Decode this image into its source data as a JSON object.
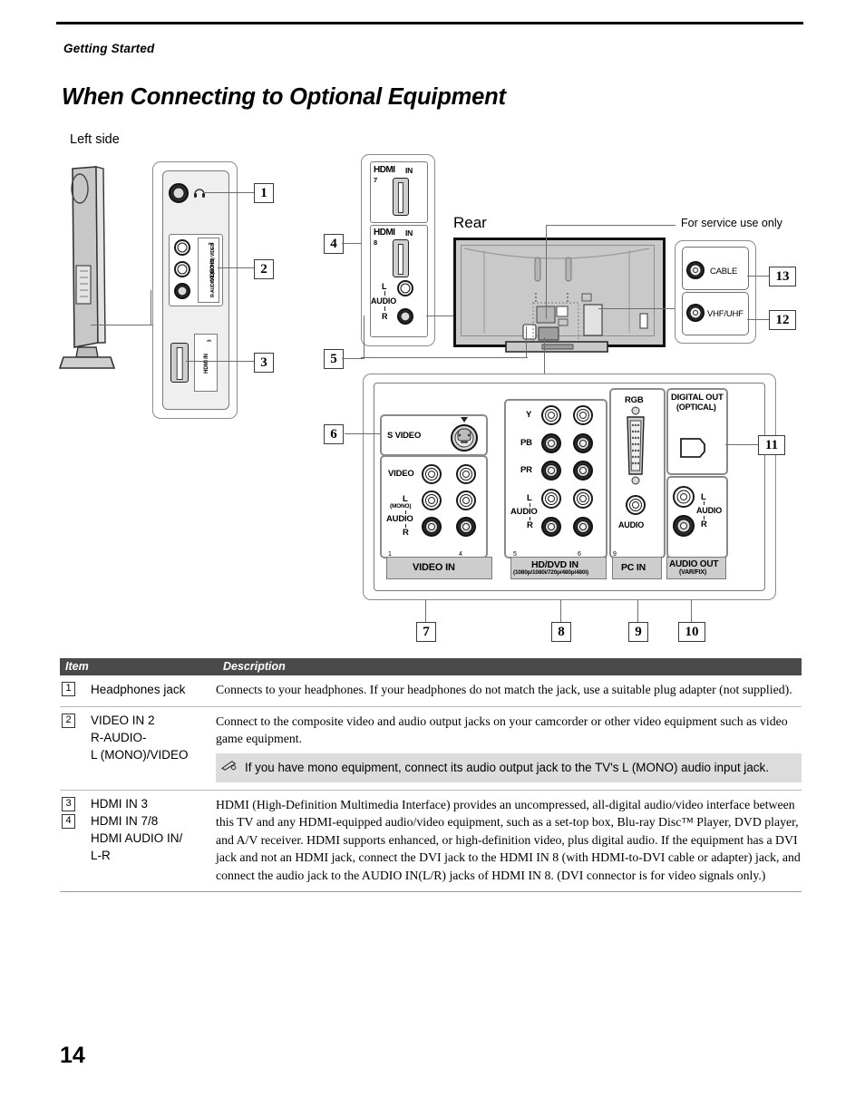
{
  "page": {
    "running_head": "Getting Started",
    "title": "When Connecting to Optional Equipment",
    "page_number": "14"
  },
  "diagram": {
    "left_side_label": "Left side",
    "rear_label": "Rear",
    "service_label": "For service use only",
    "callouts": [
      "1",
      "2",
      "3",
      "4",
      "5",
      "6",
      "7",
      "8",
      "9",
      "10",
      "11",
      "12",
      "13"
    ],
    "left_panel": {
      "video_in_label": "VIDEO IN",
      "video_in_sub": "R-AUDIO-L(MONO) VIDEO",
      "video_in_num": "2",
      "hdmi_label": "HDMI IN",
      "hdmi_num": "3"
    },
    "hdmi_module": {
      "hdmi7_label": "HDMI",
      "hdmi7_in": "IN",
      "hdmi7_num": "7",
      "hdmi8_label": "HDMI",
      "hdmi8_in": "IN",
      "hdmi8_num": "8",
      "audio_l": "L",
      "audio": "AUDIO",
      "audio_r": "R"
    },
    "antenna_module": {
      "cable": "CABLE",
      "vhf_uhf": "VHF/UHF"
    },
    "bottom_panel": {
      "svideo": "S VIDEO",
      "video": "VIDEO",
      "l_label": "L",
      "mono_label": "(MONO)",
      "audio_label": "AUDIO",
      "r_label": "R",
      "video_in_title": "VIDEO  IN",
      "video_in_n1": "1",
      "video_in_n4": "4",
      "y_label": "Y",
      "pb_label": "PB",
      "pr_label": "PR",
      "hd_l": "L",
      "hd_audio": "AUDIO",
      "hd_r": "R",
      "hddvd_title": "HD/DVD IN",
      "hddvd_sub": "(1080p/1080i/720p/480p/480i)",
      "hddvd_n5": "5",
      "hddvd_n6": "6",
      "rgb_label": "RGB",
      "pc_audio_label": "AUDIO",
      "pc_in_title": "PC IN",
      "pc_in_n9": "9",
      "digital_out_title": "DIGITAL OUT",
      "digital_out_sub": "(OPTICAL)",
      "out_l": "L",
      "out_audio": "AUDIO",
      "out_r": "R",
      "audio_out_title": "AUDIO OUT",
      "audio_out_sub": "(VAR/FIX)"
    }
  },
  "table": {
    "headers": {
      "item": "Item",
      "description": "Description"
    },
    "rows": [
      {
        "nums": [
          "1"
        ],
        "item_lines": [
          "Headphones jack"
        ],
        "description": "Connects to your headphones. If your headphones do not match the jack, use a suitable plug adapter (not supplied).",
        "note": null
      },
      {
        "nums": [
          "2"
        ],
        "item_lines": [
          "VIDEO IN 2",
          "R-AUDIO-",
          "L (MONO)/VIDEO"
        ],
        "description": "Connect to the composite video and audio output jacks on your camcorder or other video equipment such as video game equipment.",
        "note": "If you have mono equipment, connect its audio output jack to the TV's L (MONO) audio input jack."
      },
      {
        "nums": [
          "3",
          "4"
        ],
        "item_lines": [
          "HDMI IN 3",
          "HDMI IN 7/8",
          "HDMI AUDIO IN/",
          "L-R"
        ],
        "description": "HDMI (High-Definition Multimedia Interface) provides an uncompressed, all-digital audio/video interface between this TV and any HDMI-equipped audio/video equipment, such as a set-top box, Blu-ray Disc™ Player, DVD player, and A/V receiver. HDMI supports enhanced, or high-definition video, plus digital audio. If the equipment has a DVI jack and not an HDMI jack, connect the DVI jack to the HDMI IN 8 (with HDMI-to-DVI cable or adapter) jack, and connect the audio jack to the AUDIO IN(L/R) jacks of HDMI IN 8. (DVI connector is for video signals only.)",
        "note": null
      }
    ]
  },
  "colors": {
    "header_bar": "#4a4a4a",
    "note_bg": "#dcdcdc",
    "line_gray": "#6d6d6d"
  }
}
